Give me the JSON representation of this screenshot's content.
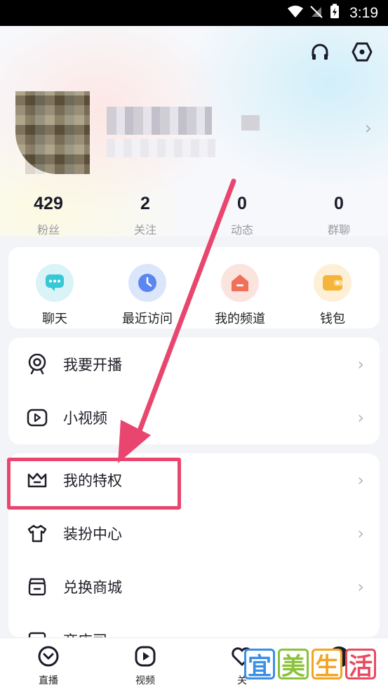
{
  "status_bar": {
    "time": "3:19"
  },
  "stats": [
    {
      "value": "429",
      "label": "粉丝"
    },
    {
      "value": "2",
      "label": "关注"
    },
    {
      "value": "0",
      "label": "动态"
    },
    {
      "value": "0",
      "label": "群聊"
    }
  ],
  "quick_actions": [
    {
      "label": "聊天",
      "icon": "chat-bubble-icon",
      "bg": "#d9f3f7",
      "fg": "#38c7d6"
    },
    {
      "label": "最近访问",
      "icon": "clock-icon",
      "bg": "#dce6fb",
      "fg": "#5b86f0"
    },
    {
      "label": "我的频道",
      "icon": "house-icon",
      "bg": "#fbe4de",
      "fg": "#f0705a"
    },
    {
      "label": "钱包",
      "icon": "wallet-icon",
      "bg": "#fdf0d6",
      "fg": "#f5b53a"
    }
  ],
  "menu_group_1": [
    {
      "label": "我要开播",
      "icon": "webcam-icon"
    },
    {
      "label": "小视频",
      "icon": "play-video-icon"
    }
  ],
  "menu_group_2": [
    {
      "label": "我的特权",
      "icon": "crown-icon"
    },
    {
      "label": "装扮中心",
      "icon": "tshirt-icon"
    },
    {
      "label": "兑换商城",
      "icon": "shop-icon"
    },
    {
      "label": "商店司",
      "icon": "partial-icon"
    }
  ],
  "tabs": [
    {
      "label": "直播",
      "icon": "live-icon"
    },
    {
      "label": "视频",
      "icon": "video-icon"
    },
    {
      "label": "关",
      "icon": "heart-icon"
    },
    {
      "label": "",
      "icon": "avatar-tab-icon"
    }
  ],
  "watermark": [
    "宜",
    "美",
    "生",
    "活"
  ],
  "colors": {
    "accent_highlight": "#e8466e",
    "chevron": "#b6b6bc"
  }
}
